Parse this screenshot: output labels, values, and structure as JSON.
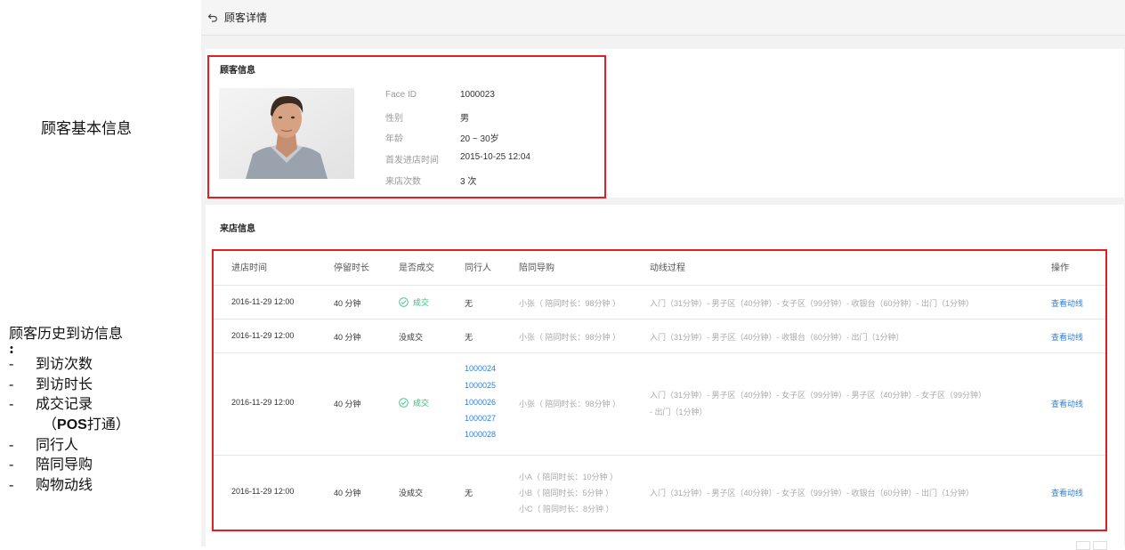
{
  "annotations": {
    "basic_info": "顾客基本信息",
    "history_title": "顾客历史到访信息",
    "history_colon": ":",
    "history_items": [
      "到访次数",
      "到访时长",
      "成交记录",
      "同行人",
      "陪同导购",
      "购物动线"
    ],
    "pos_note_pre": "（",
    "pos_note_pos": "POS",
    "pos_note_post": "打通）"
  },
  "topbar": {
    "title": "顾客详情",
    "icon": "back-arrow-icon"
  },
  "customer_card": {
    "title": "顾客信息",
    "fields": [
      {
        "label": "Face ID",
        "value": "1000023"
      },
      {
        "label": "性别",
        "value": "男"
      },
      {
        "label": "年龄",
        "value": "20 ~ 30岁"
      },
      {
        "label": "首发进店时间",
        "value": "2015-10-25 12:04"
      },
      {
        "label": "来店次数",
        "value": "3 次"
      }
    ]
  },
  "visit_card": {
    "title": "来店信息",
    "columns": [
      "进店时间",
      "停留时长",
      "是否成交",
      "同行人",
      "陪同导购",
      "动线过程",
      "操作"
    ],
    "rows": [
      {
        "time": "2016-11-29 12:00",
        "duration": "40 分钟",
        "deal": "成交",
        "deal_ok": true,
        "companions": [
          "无"
        ],
        "companions_linked": false,
        "guides": [
          "小张（ 陪同时长：98分钟 ）"
        ],
        "path_lines": [
          "入门（31分钟）- 男子区（40分钟）- 女子区（99分钟）- 收银台（60分钟）- 出门（1分钟）"
        ],
        "action": "查看动线"
      },
      {
        "time": "2016-11-29 12:00",
        "duration": "40 分钟",
        "deal": "没成交",
        "deal_ok": false,
        "companions": [
          "无"
        ],
        "companions_linked": false,
        "guides": [
          "小张（ 陪同时长：98分钟 ）"
        ],
        "path_lines": [
          "入门（31分钟）- 男子区（40分钟）- 收银台（60分钟）- 出门（1分钟）"
        ],
        "action": "查看动线"
      },
      {
        "time": "2016-11-29 12:00",
        "duration": "40 分钟",
        "deal": "成交",
        "deal_ok": true,
        "companions": [
          "1000024",
          "1000025",
          "1000026",
          "1000027",
          "1000028"
        ],
        "companions_linked": true,
        "guides": [
          "小张（ 陪同时长：98分钟 ）"
        ],
        "path_lines": [
          "入门（31分钟）- 男子区（40分钟）- 女子区（99分钟）- 男子区（40分钟）- 女子区（99分钟）",
          "- 出门（1分钟）"
        ],
        "action": "查看动线"
      },
      {
        "time": "2016-11-29 12:00",
        "duration": "40 分钟",
        "deal": "没成交",
        "deal_ok": false,
        "companions": [
          "无"
        ],
        "companions_linked": false,
        "guides": [
          "小A（ 陪同时长：10分钟 ）",
          "小B（ 陪同时长：5分钟 ）",
          "小C（ 陪同时长：8分钟 ）"
        ],
        "path_lines": [
          "入门（31分钟）- 男子区（40分钟）- 女子区（99分钟）- 收银台（60分钟）- 出门（1分钟）"
        ],
        "action": "查看动线"
      }
    ]
  },
  "colors": {
    "highlight_border": "#e02020",
    "link": "#2e7fe0",
    "success": "#2ec27e"
  }
}
